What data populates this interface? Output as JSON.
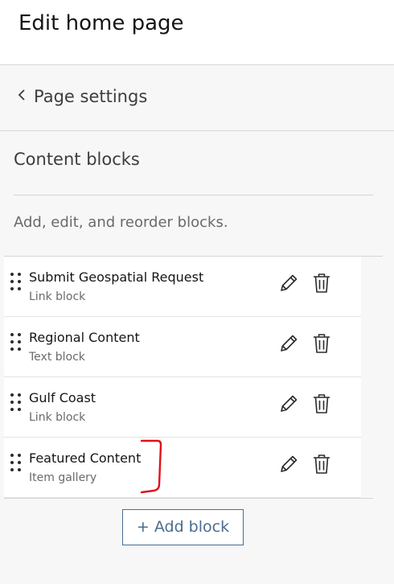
{
  "header": {
    "title": "Edit home page"
  },
  "nav": {
    "back_label": "Page settings",
    "back_icon": "chevron-left-icon"
  },
  "section": {
    "title": "Content blocks",
    "description": "Add, edit, and reorder blocks."
  },
  "blocks": [
    {
      "title": "Submit Geospatial Request",
      "type": "Link block"
    },
    {
      "title": "Regional Content",
      "type": "Text block"
    },
    {
      "title": "Gulf Coast",
      "type": "Link block"
    },
    {
      "title": "Featured Content",
      "type": "Item gallery"
    }
  ],
  "icons": {
    "drag": "drag-handle-icon",
    "edit": "pencil-icon",
    "delete": "trash-icon"
  },
  "actions": {
    "add_block_label": "+ Add block"
  },
  "colors": {
    "accent": "#4a6c8f",
    "annotation": "#e0101a"
  }
}
